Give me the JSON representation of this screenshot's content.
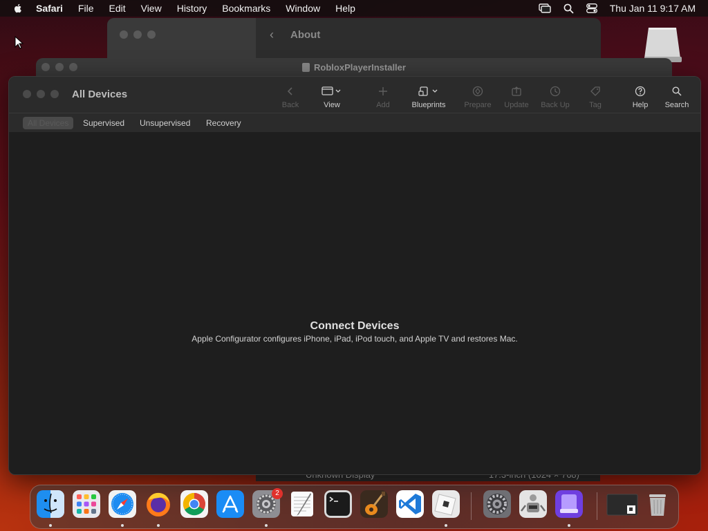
{
  "menubar": {
    "app": "Safari",
    "items": [
      "File",
      "Edit",
      "View",
      "History",
      "Bookmarks",
      "Window",
      "Help"
    ],
    "clock": "Thu Jan 11  9:17 AM"
  },
  "bg_window_about": {
    "title": "About"
  },
  "bg_window_installer": {
    "title": "RobloxPlayerInstaller"
  },
  "bottom_strip": {
    "left": "Unknown Display",
    "right": "17.3-inch (1024 × 768)"
  },
  "window": {
    "title": "All Devices",
    "toolbar": [
      {
        "label": "Back",
        "icon": "chevron-left-icon",
        "enabled": false
      },
      {
        "label": "View",
        "icon": "view-icon",
        "enabled": true
      },
      {
        "label": "Add",
        "icon": "plus-icon",
        "enabled": false
      },
      {
        "label": "Blueprints",
        "icon": "blueprints-icon",
        "enabled": true
      },
      {
        "label": "Prepare",
        "icon": "prepare-icon",
        "enabled": false
      },
      {
        "label": "Update",
        "icon": "update-icon",
        "enabled": false
      },
      {
        "label": "Back Up",
        "icon": "backup-icon",
        "enabled": false
      },
      {
        "label": "Tag",
        "icon": "tag-icon",
        "enabled": false
      },
      {
        "label": "Help",
        "icon": "help-icon",
        "enabled": true
      },
      {
        "label": "Search",
        "icon": "search-icon",
        "enabled": true
      }
    ],
    "filters": [
      "All Devices",
      "Supervised",
      "Unsupervised",
      "Recovery"
    ],
    "selected_filter": "All Devices",
    "empty_title": "Connect Devices",
    "empty_subtitle": "Apple Configurator configures iPhone, iPad, iPod touch, and Apple TV and restores Mac."
  },
  "dock": {
    "apps": [
      "Finder",
      "Launchpad",
      "Safari",
      "Firefox",
      "Chrome",
      "App Store",
      "System Preferences",
      "TextEdit",
      "Terminal",
      "GarageBand",
      "Visual Studio Code",
      "Roblox",
      "System Settings",
      "Automator",
      "Apple Configurator",
      "Folder",
      "Trash"
    ],
    "badge_count": "2"
  }
}
